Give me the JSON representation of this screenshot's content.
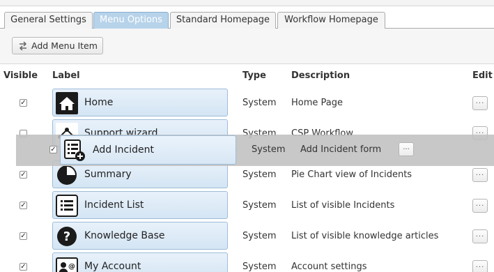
{
  "tabs": [
    {
      "label": "General Settings"
    },
    {
      "label": "Menu Options"
    },
    {
      "label": "Standard Homepage"
    },
    {
      "label": "Workflow Homepage"
    }
  ],
  "active_tab": "Menu Options",
  "toolbar": {
    "add_menu_item_label": "Add Menu Item",
    "add_icon": "swap-arrows-icon"
  },
  "columns": {
    "visible": "Visible",
    "label": "Label",
    "type": "Type",
    "description": "Description",
    "edit": "Edit"
  },
  "edit_button_label": "...",
  "rows": [
    {
      "label": "Home",
      "icon": "home-icon",
      "type": "System",
      "description": "Home Page",
      "checked": true
    },
    {
      "label": "Support wizard",
      "icon": "workflow-icon",
      "type": "System",
      "description": "CSP Workflow",
      "checked": false
    },
    {
      "label": "Summary",
      "icon": "pie-chart-icon",
      "type": "System",
      "description": "Pie Chart view of Incidents",
      "checked": true
    },
    {
      "label": "Incident List",
      "icon": "list-icon",
      "type": "System",
      "description": "List of visible Incidents",
      "checked": true
    },
    {
      "label": "Knowledge Base",
      "icon": "question-icon",
      "type": "System",
      "description": "List of visible knowledge articles",
      "checked": true
    },
    {
      "label": "My Account",
      "icon": "account-icon",
      "type": "System",
      "description": "Account settings",
      "checked": true
    }
  ],
  "dragging_row": {
    "label": "Add Incident",
    "icon": "add-incident-icon",
    "type": "System",
    "description": "Add Incident form",
    "checked": true
  },
  "colors": {
    "active_tab": "#b7d3ea",
    "pill_border": "#9dbcd8",
    "drag_overlay": "#c0c0c0"
  }
}
